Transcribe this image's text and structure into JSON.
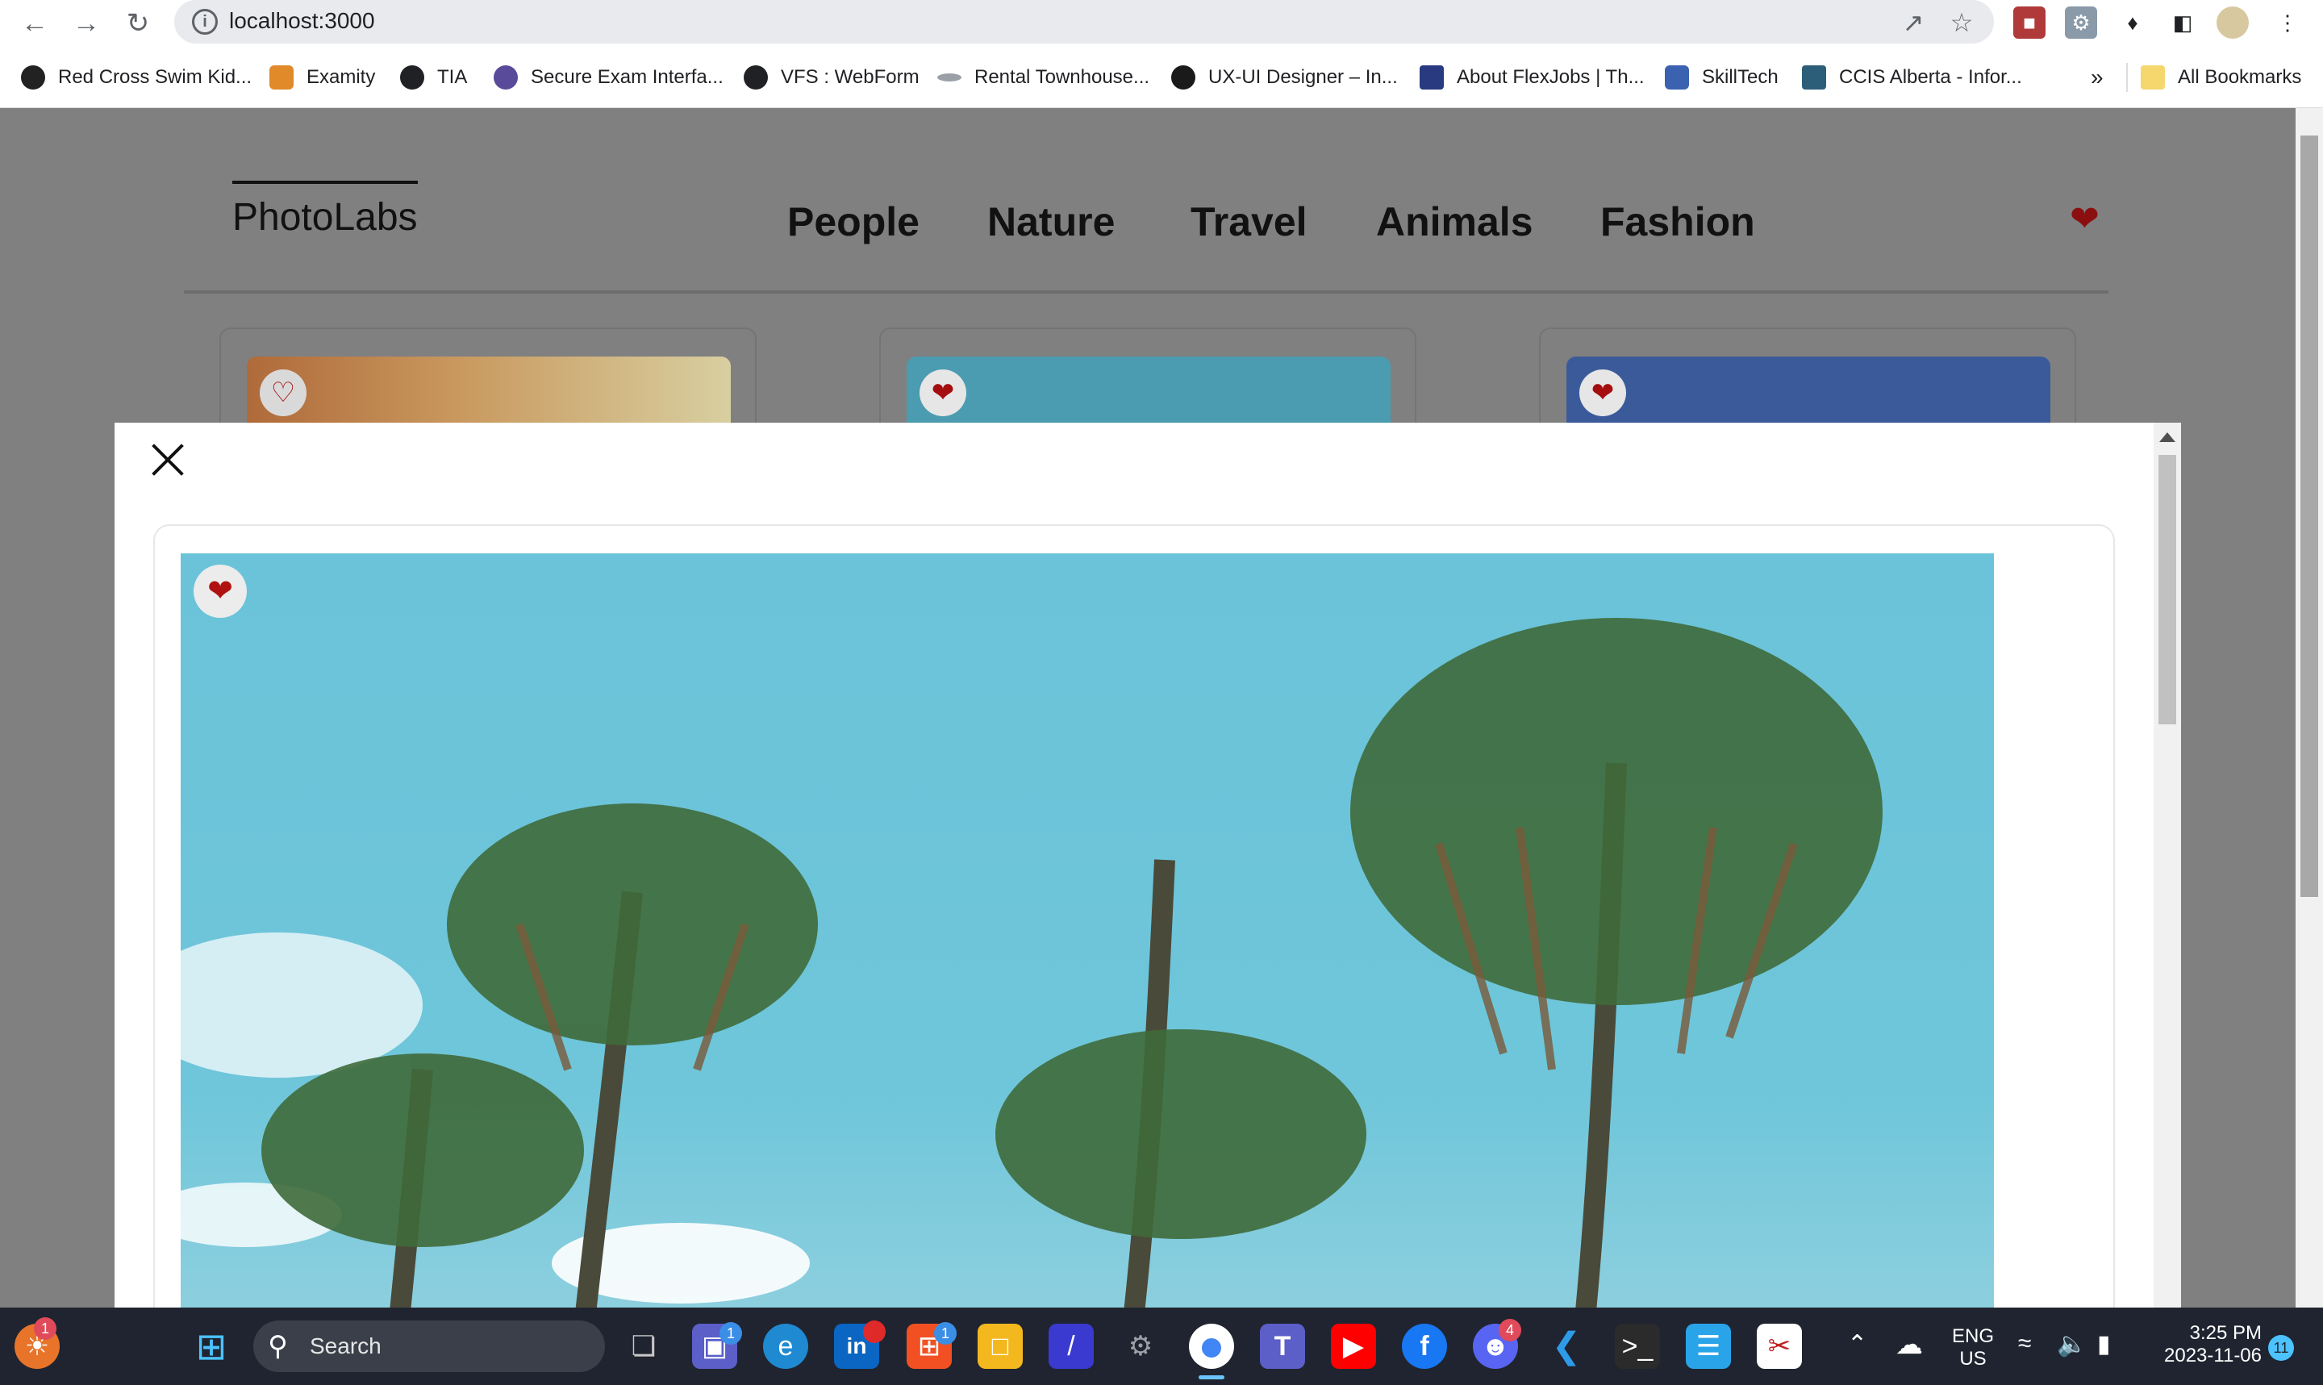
{
  "browser": {
    "url": "localhost:3000",
    "bookmarks": [
      {
        "label": "Red Cross Swim Kid...",
        "color": "#222222"
      },
      {
        "label": "Examity",
        "color": "#e08a2a"
      },
      {
        "label": "TIA",
        "color": "#202124"
      },
      {
        "label": "Secure Exam Interfa...",
        "color": "#5a4a9a"
      },
      {
        "label": "VFS : WebForm",
        "color": "#202124"
      },
      {
        "label": "Rental Townhouse...",
        "color": "#9aa0a6"
      },
      {
        "label": "UX-UI Designer – In...",
        "color": "#1a1a1a"
      },
      {
        "label": "About FlexJobs | Th...",
        "color": "#2a3a80"
      },
      {
        "label": "SkillTech",
        "color": "#3a62b0"
      },
      {
        "label": "CCIS Alberta - Infor...",
        "color": "#2c5e7a"
      }
    ],
    "overflow_label": "»",
    "all_bookmarks_label": "All Bookmarks"
  },
  "app": {
    "logo": "PhotoLabs",
    "topics": [
      "People",
      "Nature",
      "Travel",
      "Animals",
      "Fashion"
    ],
    "favourite_indicator_color": "#8b0f0f"
  },
  "cards": [
    {
      "favourited": false,
      "image_tone": "#b07a4a"
    },
    {
      "favourited": true,
      "image_tone": "#4b9cb0"
    },
    {
      "favourited": true,
      "image_tone": "#3a5a9a"
    }
  ],
  "modal": {
    "photo_favourited": true,
    "photo_subject": "palm trees against blue sky"
  },
  "taskbar": {
    "search_placeholder": "Search",
    "language": "ENG",
    "region": "US",
    "time": "3:25 PM",
    "date": "2023-11-06",
    "notification_count": "11",
    "badges": {
      "start_app": "1",
      "meet": "1",
      "store": "1",
      "discord": "4"
    }
  }
}
